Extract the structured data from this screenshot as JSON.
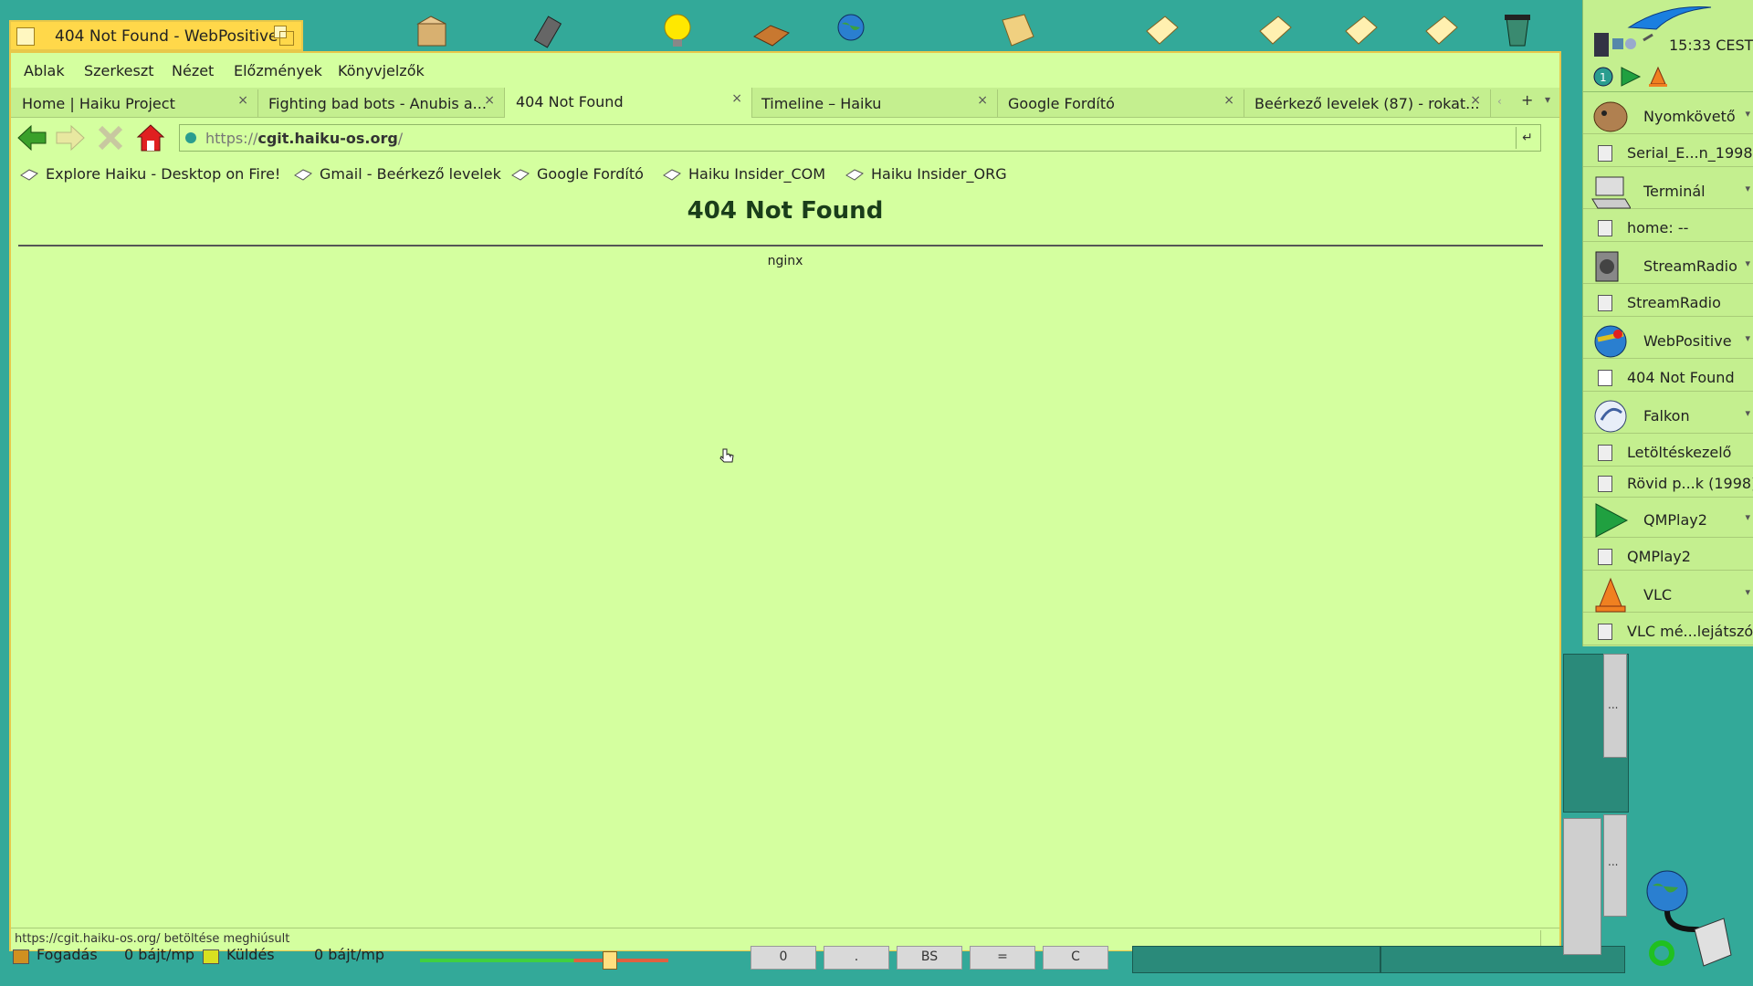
{
  "window": {
    "title": "404 Not Found - WebPositive"
  },
  "menu": [
    "Ablak",
    "Szerkeszt",
    "Nézet",
    "Előzmények",
    "Könyvjelzők"
  ],
  "tabs": [
    {
      "label": "Home | Haiku Project",
      "active": false
    },
    {
      "label": "Fighting bad bots - Anubis a...",
      "active": false
    },
    {
      "label": "404 Not Found",
      "active": true
    },
    {
      "label": "Timeline – Haiku",
      "active": false
    },
    {
      "label": "Google Fordító",
      "active": false
    },
    {
      "label": "Beérkező levelek (87) - rokat...",
      "active": false
    }
  ],
  "tab_close": "×",
  "tab_new": "+",
  "url": {
    "scheme": "https://",
    "host": "cgit.haiku-os.org",
    "path": "/",
    "go": "↵"
  },
  "bookmarks": [
    "Explore Haiku - Desktop on Fire!",
    "Gmail - Beérkező levelek",
    "Google Fordító",
    "Haiku Insider_COM",
    "Haiku Insider_ORG"
  ],
  "page": {
    "heading": "404 Not Found",
    "server": "nginx"
  },
  "status": "https://cgit.haiku-os.org/ betöltése meghiúsult",
  "deskbar": {
    "clock": "15:33 CEST",
    "entries": [
      {
        "type": "app",
        "name": "Nyomkövető"
      },
      {
        "type": "win",
        "name": "Serial_E...n_1998"
      },
      {
        "type": "app",
        "name": "Terminál"
      },
      {
        "type": "win",
        "name": "home: --"
      },
      {
        "type": "app",
        "name": "StreamRadio"
      },
      {
        "type": "win",
        "name": "StreamRadio"
      },
      {
        "type": "app",
        "name": "WebPositive"
      },
      {
        "type": "win",
        "name": "404 Not Found"
      },
      {
        "type": "app",
        "name": "Falkon"
      },
      {
        "type": "win",
        "name": "Letöltéskezelő"
      },
      {
        "type": "win",
        "name": "Rövid p...k (1998)"
      },
      {
        "type": "app",
        "name": "QMPlay2"
      },
      {
        "type": "win",
        "name": "QMPlay2"
      },
      {
        "type": "app",
        "name": "VLC"
      },
      {
        "type": "win",
        "name": "VLC mé...lejátszó"
      }
    ]
  },
  "bottom": {
    "receive_label": "Fogadás",
    "receive_rate": "0 bájt/mp",
    "send_label": "Küldés",
    "send_rate": "0 bájt/mp",
    "calc_buttons": [
      "0",
      ".",
      "BS",
      "=",
      "C"
    ],
    "ellipsis": "..."
  }
}
